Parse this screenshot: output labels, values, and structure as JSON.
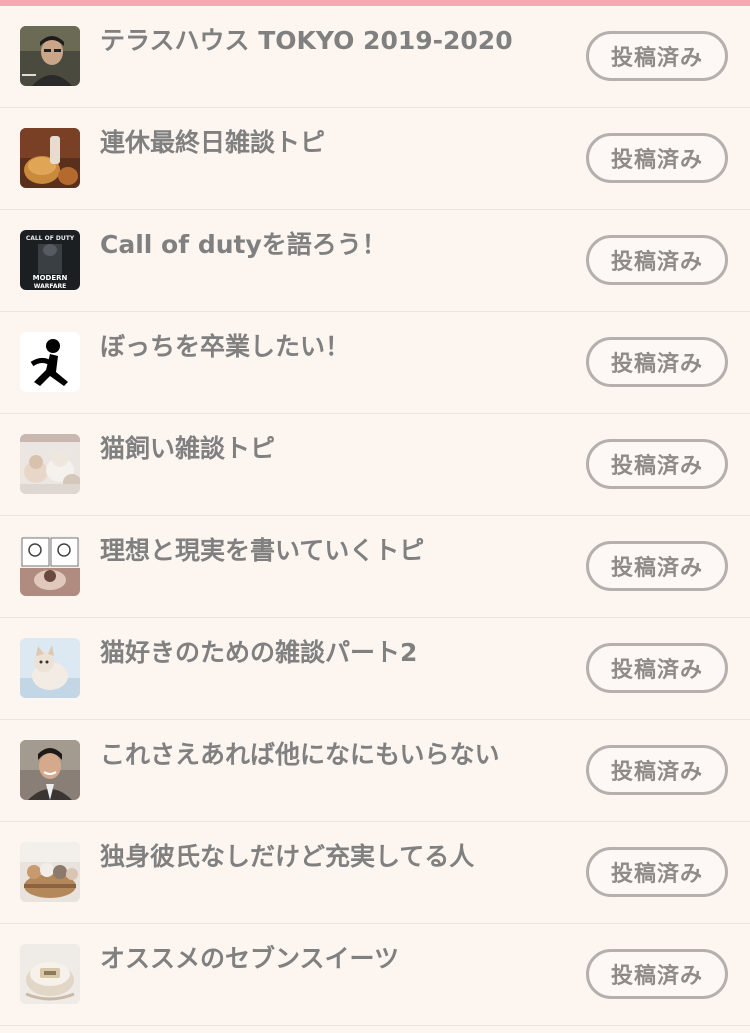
{
  "topics": [
    {
      "title": "テラスハウス TOKYO 2019-2020",
      "status": "投稿済み",
      "thumb": "man-portrait"
    },
    {
      "title": "連休最終日雑談トピ",
      "status": "投稿済み",
      "thumb": "bread-photo"
    },
    {
      "title": "Call of dutyを語ろう！",
      "status": "投稿済み",
      "thumb": "game-cover",
      "thumb_text": [
        "CALL OF DUTY",
        "MODERN",
        "WARFARE"
      ]
    },
    {
      "title": "ぼっちを卒業したい！",
      "status": "投稿済み",
      "thumb": "sitting-person-icon"
    },
    {
      "title": "猫飼い雑談トピ",
      "status": "投稿済み",
      "thumb": "kittens-photo"
    },
    {
      "title": "理想と現実を書いていくトピ",
      "status": "投稿済み",
      "thumb": "comic-collage"
    },
    {
      "title": "猫好きのための雑談パート2",
      "status": "投稿済み",
      "thumb": "kitten-photo"
    },
    {
      "title": "これさえあれば他になにもいらない",
      "status": "投稿済み",
      "thumb": "man-smiling-photo"
    },
    {
      "title": "独身彼氏なしだけど充実してる人",
      "status": "投稿済み",
      "thumb": "cats-basket-photo"
    },
    {
      "title": "オススメのセブンスイーツ",
      "status": "投稿済み",
      "thumb": "sweets-package-photo"
    }
  ],
  "colors": {
    "accent_bar": "#f2aab0",
    "background": "#fcf5f0",
    "title_text": "#808080",
    "button_border": "#b5b0ad"
  }
}
